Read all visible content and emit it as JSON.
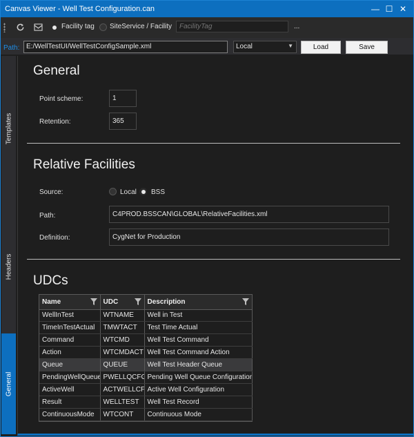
{
  "window": {
    "title": "Canvas Viewer - Well Test Configuration.can",
    "minimize": "—",
    "maximize": "☐",
    "close": "✕"
  },
  "toolbar": {
    "refresh_icon": "refresh-icon",
    "envelope_icon": "envelope-icon",
    "radio_facility_tag": "Facility tag",
    "radio_siteservice": "SiteService / Facility",
    "facility_placeholder": "FacilityTag",
    "ellipsis": "..."
  },
  "pathbar": {
    "label": "Path:",
    "path_value": "E:/WellTestUI/WellTestConfigSample.xml",
    "location": "Local",
    "load": "Load",
    "save": "Save"
  },
  "sidebar": {
    "tabs": [
      "Templates",
      "Headers",
      "General"
    ],
    "active": "General"
  },
  "general": {
    "heading": "General",
    "point_scheme_label": "Point scheme:",
    "point_scheme_value": "1",
    "retention_label": "Retention:",
    "retention_value": "365"
  },
  "relative": {
    "heading": "Relative Facilities",
    "source_label": "Source:",
    "source_local": "Local",
    "source_bss": "BSS",
    "source_selected": "BSS",
    "path_label": "Path:",
    "path_value": "C4PROD.BSSCAN\\GLOBAL\\RelativeFacilities.xml",
    "definition_label": "Definition:",
    "definition_value": "CygNet for Production"
  },
  "udcs": {
    "heading": "UDCs",
    "columns": [
      "Name",
      "UDC",
      "Description"
    ],
    "rows": [
      [
        "WellInTest",
        "WTNAME",
        "Well in Test"
      ],
      [
        "TimeInTestActual",
        "TMWTACT",
        "Test Time Actual"
      ],
      [
        "Command",
        "WTCMD",
        "Well Test Command"
      ],
      [
        "Action",
        "WTCMDACT",
        "Well Test Command Action"
      ],
      [
        "Queue",
        "QUEUE",
        "Well Test Header Queue"
      ],
      [
        "PendingWellQueue",
        "PWELLQCFG",
        "Pending Well Queue Configuration"
      ],
      [
        "ActiveWell",
        "ACTWELLCFG",
        "Active Well Configuration"
      ],
      [
        "Result",
        "WELLTEST",
        "Well Test Record"
      ],
      [
        "ContinuousMode",
        "WTCONT",
        "Continuous Mode"
      ]
    ],
    "selected_row": 4
  },
  "colors": {
    "accent": "#0d6fbf",
    "background": "#1e1e1e",
    "path_label": "#1e8ee8"
  }
}
